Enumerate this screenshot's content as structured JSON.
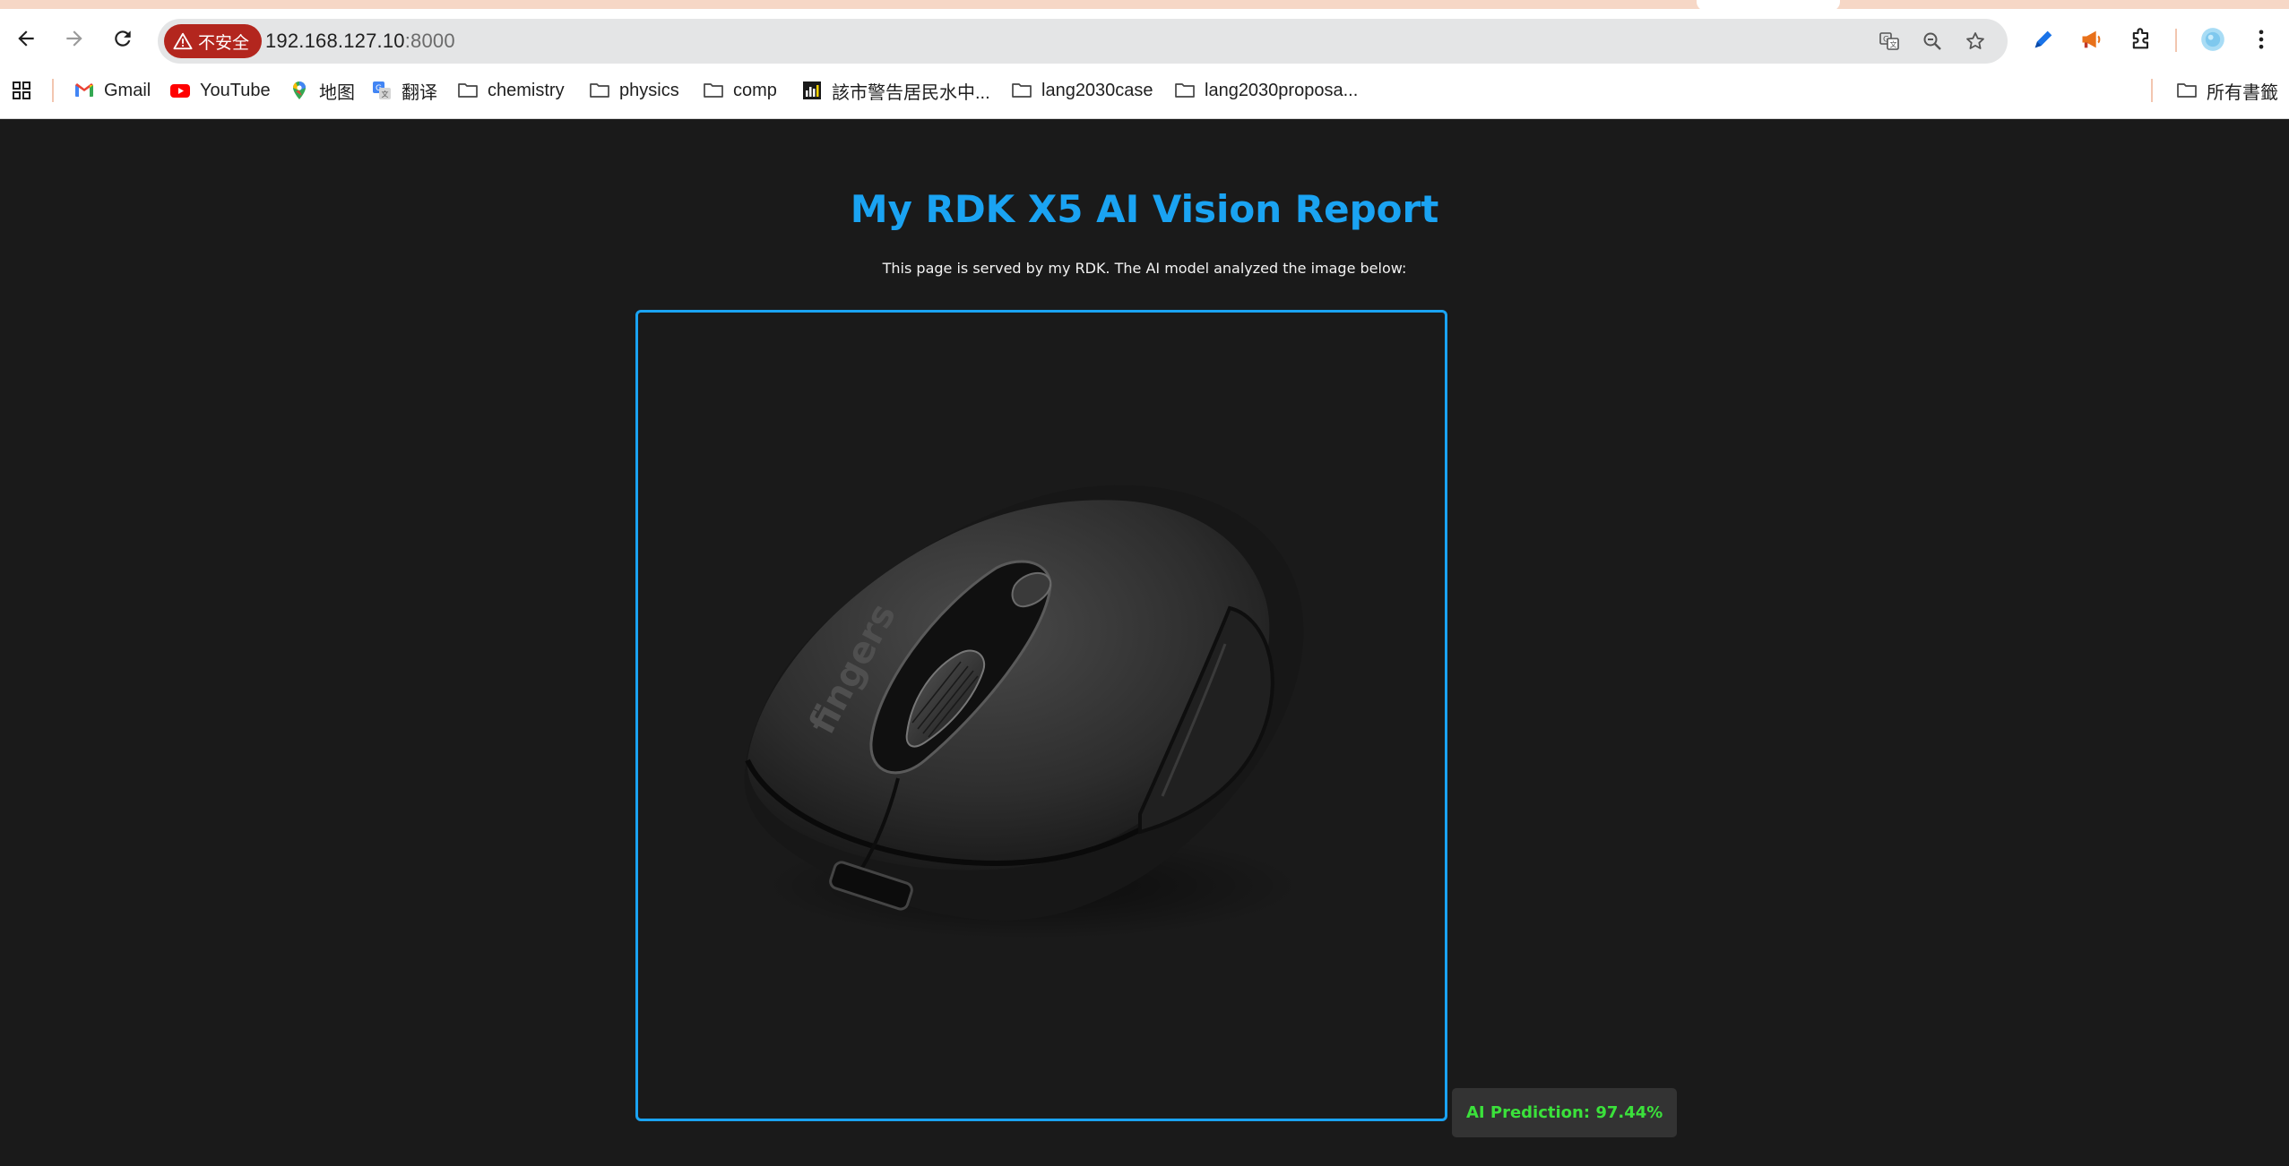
{
  "browser": {
    "security_label": "不安全",
    "url_host": "192.168.127.10",
    "url_port": ":8000",
    "bookmarks": [
      {
        "label": "Gmail",
        "icon": "gmail-icon"
      },
      {
        "label": "YouTube",
        "icon": "youtube-icon"
      },
      {
        "label": "地图",
        "icon": "maps-icon"
      },
      {
        "label": "翻译",
        "icon": "translate-icon"
      },
      {
        "label": "chemistry",
        "icon": "folder-icon"
      },
      {
        "label": "physics",
        "icon": "folder-icon"
      },
      {
        "label": "comp",
        "icon": "folder-icon"
      },
      {
        "label": "該市警告居民水中...",
        "icon": "site-icon"
      },
      {
        "label": "lang2030case",
        "icon": "folder-icon"
      },
      {
        "label": "lang2030proposa...",
        "icon": "folder-icon"
      }
    ],
    "all_bookmarks_label": "所有書籤"
  },
  "page": {
    "title": "My RDK X5 AI Vision Report",
    "subtitle": "This page is served by my RDK. The AI model analyzed the image below:",
    "image_text": "fingers",
    "prediction": "AI Prediction: 97.44%"
  },
  "colors": {
    "accent": "#1aa3f2",
    "prediction_text": "#3be13b",
    "background": "#1a1a1a",
    "warning_chip": "#b3261e"
  }
}
